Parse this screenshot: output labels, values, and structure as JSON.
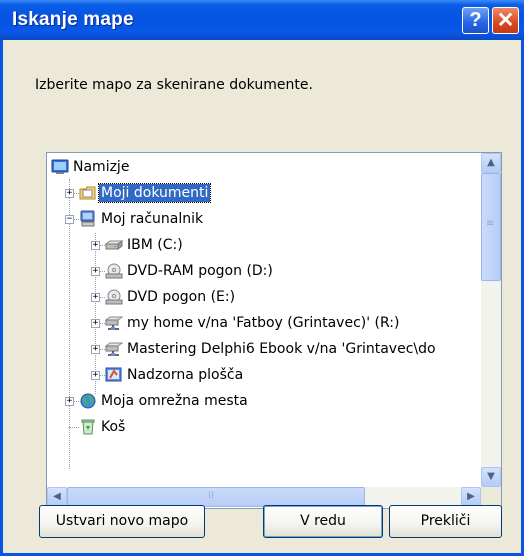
{
  "window": {
    "title": "Iskanje mape",
    "help_label": "?",
    "close_label": "✕"
  },
  "prompt": "Izberite mapo za skenirane dokumente.",
  "tree": {
    "items": [
      {
        "label": "Namizje",
        "icon": "desktop-icon"
      },
      {
        "label": "Moji dokumenti",
        "icon": "my-documents-folder-icon",
        "selected": true
      },
      {
        "label": "Moj računalnik",
        "icon": "my-computer-icon"
      },
      {
        "label": "IBM (C:)",
        "icon": "hard-drive-icon"
      },
      {
        "label": "DVD-RAM pogon (D:)",
        "icon": "dvd-drive-icon"
      },
      {
        "label": "DVD pogon (E:)",
        "icon": "dvd-drive-icon"
      },
      {
        "label": "my home v/na 'Fatboy (Grintavec)' (R:)",
        "icon": "network-drive-icon"
      },
      {
        "label": "Mastering Delphi6 Ebook v/na 'Grintavec\\do",
        "icon": "network-drive-icon"
      },
      {
        "label": "Nadzorna plošča",
        "icon": "control-panel-icon"
      },
      {
        "label": "Moja omrežna mesta",
        "icon": "network-places-icon"
      },
      {
        "label": "Koš",
        "icon": "recycle-bin-icon"
      }
    ]
  },
  "scrollbars": {
    "vertical_position": 0.0,
    "horizontal_position": 0.0
  },
  "buttons": {
    "new_folder": "Ustvari novo mapo",
    "ok": "V redu",
    "cancel": "Prekliči"
  },
  "colors": {
    "titlebar": "#0553e0",
    "selection": "#316ac5",
    "dialog_face": "#ece9d8"
  }
}
